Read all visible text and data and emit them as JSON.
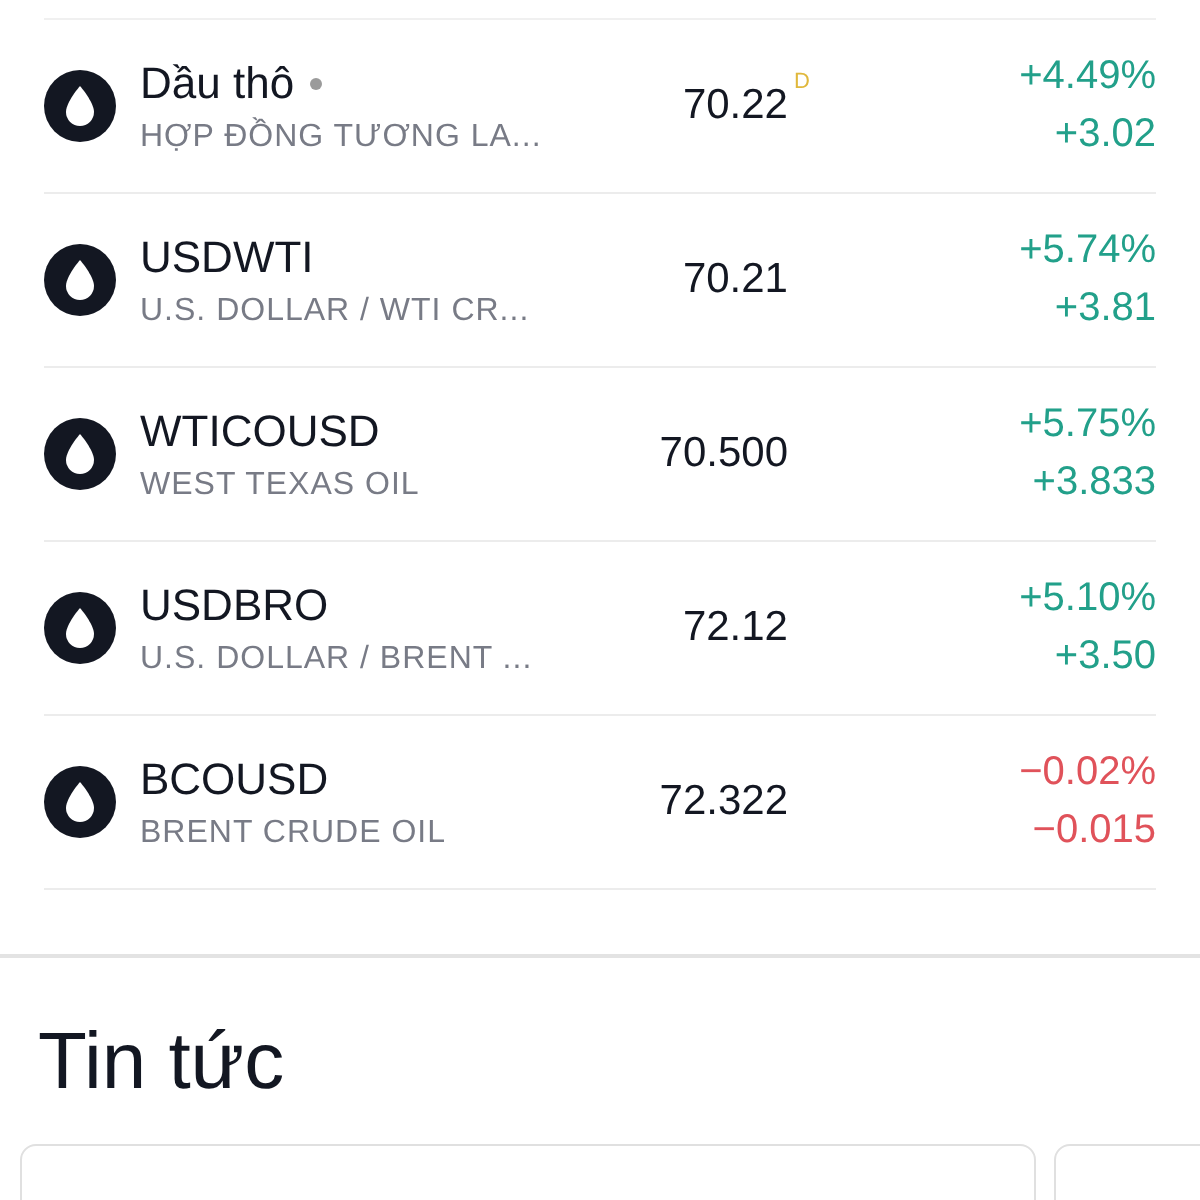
{
  "symbols": [
    {
      "name": "Dầu thô",
      "status_dot": true,
      "description": "HỢP ĐỒNG TƯƠNG LA...",
      "price": "70.22",
      "price_flag": "D",
      "change_percent": "+4.49%",
      "change": "+3.02",
      "negative": false
    },
    {
      "name": "USDWTI",
      "status_dot": false,
      "description": "U.S. DOLLAR / WTI CR...",
      "price": "70.21",
      "change_percent": "+5.74%",
      "change": "+3.81",
      "negative": false
    },
    {
      "name": "WTICOUSD",
      "status_dot": false,
      "description": "WEST TEXAS OIL",
      "price": "70.500",
      "change_percent": "+5.75%",
      "change": "+3.833",
      "negative": false
    },
    {
      "name": "USDBRO",
      "status_dot": false,
      "description": "U.S. DOLLAR / BRENT ...",
      "price": "72.12",
      "change_percent": "+5.10%",
      "change": "+3.50",
      "negative": false
    },
    {
      "name": "BCOUSD",
      "status_dot": false,
      "description": "BRENT CRUDE OIL",
      "price": "72.322",
      "change_percent": "−0.02%",
      "change": "−0.015",
      "negative": true
    }
  ],
  "news": {
    "title": "Tin tức",
    "cards": [
      {
        "kind": "card"
      },
      {
        "kind": "card"
      }
    ]
  }
}
